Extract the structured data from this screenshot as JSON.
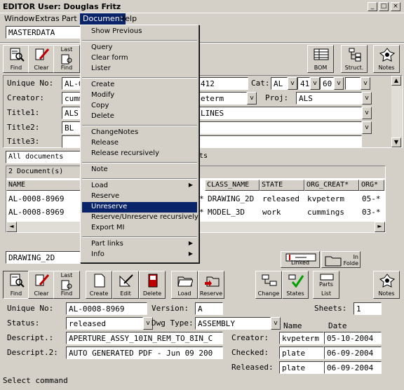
{
  "window": {
    "title": "EDITOR User: Douglas Fritz"
  },
  "menubar": [
    "Window",
    "Extras",
    "Part",
    "Document",
    "Help"
  ],
  "document_menu": {
    "groups": [
      [
        "Show Previous"
      ],
      [
        "Query",
        "Clear form",
        "Lister"
      ],
      [
        "Create",
        "Modify",
        "Copy",
        "Delete"
      ],
      [
        "ChangeNotes",
        "Release",
        "Release recursively"
      ],
      [
        "Note"
      ],
      [
        "Load",
        "Reserve",
        "Unreserve",
        "Reserve/Unreserve recursively",
        "Export MI"
      ],
      [
        "Part links",
        "Info"
      ]
    ],
    "highlighted": "Unreserve"
  },
  "part": {
    "mode_value": "MASTERDATA",
    "toolbar": {
      "find": "Find",
      "clear": "Clear",
      "last_find_top": "Last",
      "last_find_bottom": "Find",
      "bom": "BOM",
      "struct": "Struct.",
      "notes": "Notes"
    },
    "unique_label": "Unique No:",
    "unique_value": "AL-0",
    "unique_value2": "412",
    "cat_label": "Cat:",
    "cat_value": "AL",
    "cat_num1": "41",
    "cat_num2": "60",
    "creator_label": "Creator:",
    "creator_value": "cumm",
    "creator_value2": "eterm",
    "proj_label": "Proj:",
    "proj_value": "ALS",
    "title1_label": "Title1:",
    "title1_value": "ALS",
    "title1_value2": "LINES",
    "title2_label": "Title2:",
    "title2_value": "BL",
    "title3_label": "Title3:"
  },
  "doclist": {
    "filter_value": "All documents",
    "filter_suffix": "ts",
    "count_text": "2 Document(s) ",
    "columns": [
      "NAME",
      "CLASS_NAME",
      "STATE",
      "ORG_CREAT*",
      "ORG*"
    ],
    "rows": [
      {
        "name": "AL-0008-8969",
        "class": "DRAWING_2D",
        "state": "released",
        "creator": "kvpeterm",
        "org": "05-*"
      },
      {
        "name": "AL-0008-8969",
        "class": "MODEL_3D",
        "state": "work",
        "creator": "cummings",
        "org": "03-*"
      }
    ],
    "row_marker": "*"
  },
  "doc": {
    "class_value": "DRAWING_2D",
    "linked_label": "Linked",
    "infolder_label": "In Folde",
    "toolbar": {
      "find": "Find",
      "clear": "Clear",
      "last_find_top": "Last",
      "last_find_bottom": "Find",
      "create": "Create",
      "edit": "Edit",
      "delete": "Delete",
      "load": "Load",
      "reserve": "Reserve",
      "change": "Change",
      "states": "States",
      "parts_top": "Parts",
      "parts_bottom": "List",
      "notes": "Notes"
    },
    "unique_label": "Unique No:",
    "unique_value": "AL-0008-8969",
    "version_label": "Version:",
    "version_value": "A",
    "sheets_label": "Sheets:",
    "sheets_value": "1",
    "status_label": "Status:",
    "status_value": "released",
    "dwgtype_label": "Dwg Type:",
    "dwgtype_value": "ASSEMBLY",
    "descript_label": "Descript.:",
    "descript_value": "APERTURE_ASSY_10IN_REM_TO_8IN_C",
    "descript2_label": "Descript.2:",
    "descript2_value": "AUTO GENERATED PDF - Jun 09 200",
    "name_header": "Name",
    "date_header": "Date",
    "creator_label": "Creator:",
    "creator_name": "kvpeterm",
    "creator_date": "05-10-2004",
    "checked_label": "Checked:",
    "checked_name": "plate",
    "checked_date": "06-09-2004",
    "released_label": "Released:",
    "released_name": "plate",
    "released_date": "06-09-2004"
  },
  "status_bar": "Select command",
  "colors": {
    "face": "#d4d0c8",
    "highlight": "#0a246a",
    "field": "#ffffff"
  }
}
